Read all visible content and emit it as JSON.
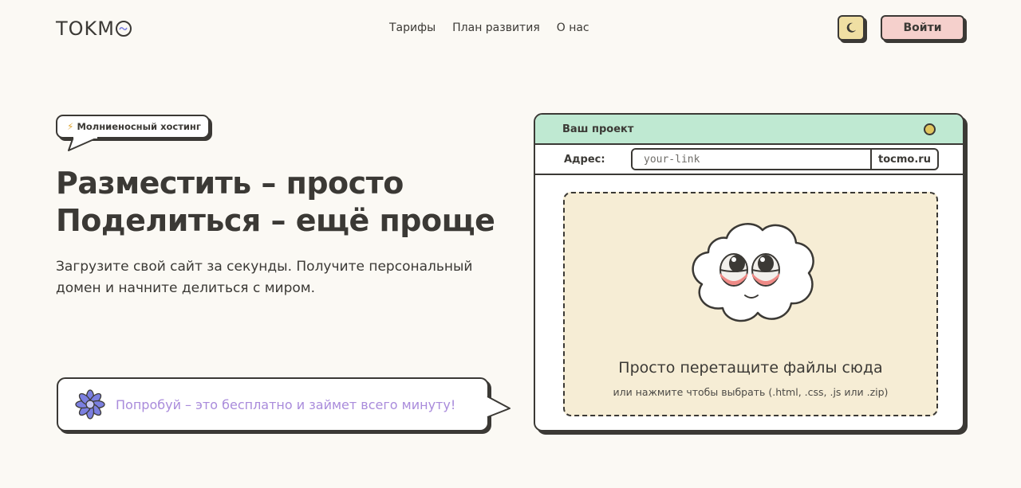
{
  "header": {
    "logo_text": "TOKM",
    "nav": [
      "Тарифы",
      "План развития",
      "О нас"
    ],
    "theme_icon": "moon-icon",
    "login_label": "Войти"
  },
  "hero": {
    "badge_icon": "lightning-icon",
    "badge_text": "Молниеносный хостинг",
    "title_line1": "Разместить – просто",
    "title_line2": "Поделиться – ещё проще",
    "subtitle": "Загрузите свой сайт за секунды. Получите персональный домен и начните делиться с миром.",
    "cta_icon": "flower-icon",
    "cta_text": "Попробуй – это бесплатно и займет всего минуту!"
  },
  "uploader": {
    "window_title": "Ваш проект",
    "address_label": "Адрес:",
    "address_value": "your-link",
    "domain": "tocmo.ru",
    "drop_title": "Просто перетащите файлы сюда",
    "drop_hint": "или нажмите чтобы выбрать (.html, .css, .js или .zip)",
    "mascot_icon": "cloud-mascot-icon"
  },
  "colors": {
    "background": "#fbf9f4",
    "ink": "#3b3935",
    "login_bg": "#f5d0cc",
    "theme_bg": "#f0dfa3",
    "card_header": "#bfe9d2",
    "dropzone": "#f6edd5",
    "cta_text": "#a98bdb",
    "flower": "#7b7fe0"
  }
}
